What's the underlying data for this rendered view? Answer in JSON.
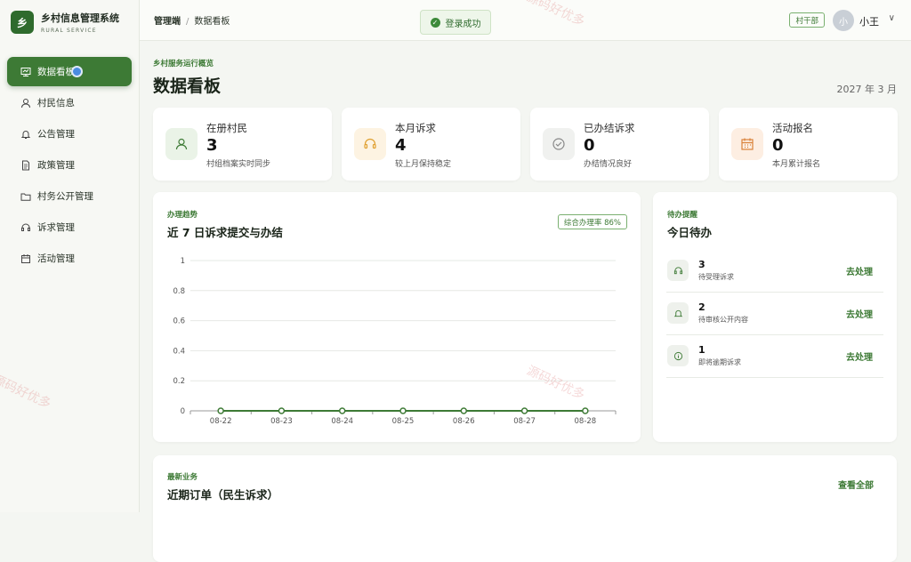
{
  "brand": {
    "logo": "乡",
    "title": "乡村信息管理系统",
    "subtitle": "RURAL SERVICE"
  },
  "sidebar": {
    "items": [
      {
        "label": "数据看板",
        "icon": "dashboard-icon"
      },
      {
        "label": "村民信息",
        "icon": "user-icon"
      },
      {
        "label": "公告管理",
        "icon": "bell-icon"
      },
      {
        "label": "政策管理",
        "icon": "document-icon"
      },
      {
        "label": "村务公开管理",
        "icon": "folder-icon"
      },
      {
        "label": "诉求管理",
        "icon": "headset-icon"
      },
      {
        "label": "活动管理",
        "icon": "calendar-icon"
      }
    ]
  },
  "header": {
    "breadcrumb_root": "管理端",
    "breadcrumb_sep": "/",
    "breadcrumb_current": "数据看板",
    "toast": "登录成功",
    "role": "村干部",
    "avatar": "小",
    "username": "小王"
  },
  "overview": {
    "label": "乡村服务运行概览",
    "title": "数据看板",
    "date": "2027 年 3 月"
  },
  "stats": [
    {
      "label": "在册村民",
      "value": "3",
      "sub": "村组档案实时同步",
      "color": "#eaf3e7"
    },
    {
      "label": "本月诉求",
      "value": "4",
      "sub": "较上月保持稳定",
      "color": "#fdf3e2"
    },
    {
      "label": "已办结诉求",
      "value": "0",
      "sub": "办结情况良好",
      "color": "#f0f1ef"
    },
    {
      "label": "活动报名",
      "value": "0",
      "sub": "本月累计报名",
      "color": "#fdeee2"
    }
  ],
  "trend": {
    "label": "办理趋势",
    "title": "近 7 日诉求提交与办结",
    "badge": "综合办理率 86%"
  },
  "chart_data": {
    "type": "line",
    "x": [
      "08-22",
      "08-23",
      "08-24",
      "08-25",
      "08-26",
      "08-27",
      "08-28"
    ],
    "series": [
      {
        "values": [
          0,
          0,
          0,
          0,
          0,
          0,
          0
        ]
      }
    ],
    "ylim": [
      0,
      1
    ],
    "yticks": [
      "1",
      "0.8",
      "0.6",
      "0.4",
      "0.2",
      "0"
    ],
    "grid": true,
    "color": "#3d7a35"
  },
  "todo": {
    "label": "待办提醒",
    "title": "今日待办",
    "items": [
      {
        "count": "3",
        "label": "待受理诉求",
        "action": "去处理"
      },
      {
        "count": "2",
        "label": "待审核公开内容",
        "action": "去处理"
      },
      {
        "count": "1",
        "label": "即将逾期诉求",
        "action": "去处理"
      }
    ]
  },
  "orders": {
    "label": "最新业务",
    "title": "近期订单（民生诉求）",
    "view_all": "查看全部"
  },
  "watermark": "源码好优多"
}
